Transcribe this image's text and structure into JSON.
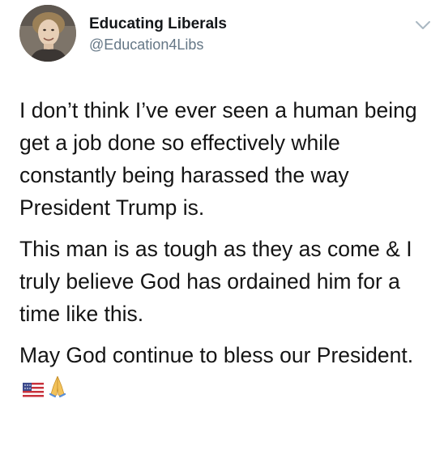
{
  "tweet": {
    "author_name": "Educating Liberals",
    "author_handle": "@Education4Libs",
    "paragraphs": [
      "I don’t think I’ve ever seen a human being get a job done so effectively while constantly being harassed the way President Trump is.",
      "This man is as tough as they as come & I truly believe God has ordained him for a time like this.",
      "May God continue to bless our President."
    ],
    "trailing_emoji": [
      "us-flag-emoji",
      "folded-hands-emoji"
    ]
  },
  "colors": {
    "handle": "#657786",
    "chevron": "#aab8c2",
    "text": "#141414"
  }
}
